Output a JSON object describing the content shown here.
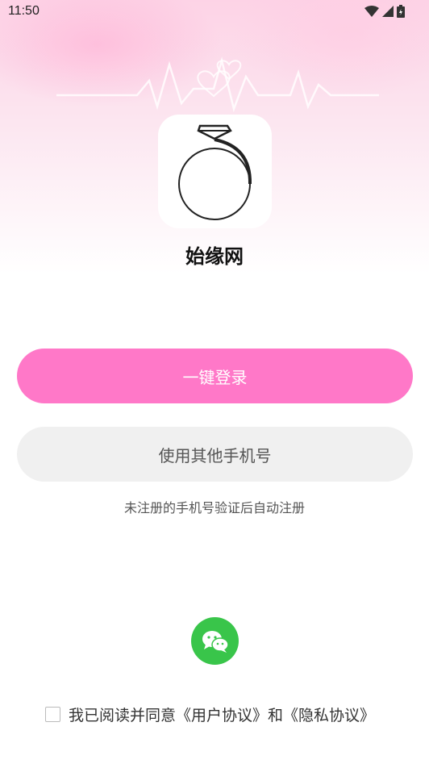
{
  "status_bar": {
    "time": "11:50"
  },
  "app": {
    "name": "始缘网",
    "logo_icon": "diamond-ring-icon"
  },
  "buttons": {
    "one_click_login": "一键登录",
    "other_phone": "使用其他手机号"
  },
  "hint": "未注册的手机号验证后自动注册",
  "social": {
    "wechat_icon": "wechat-icon"
  },
  "agreement": {
    "prefix": "我已阅读并同意",
    "user_agreement": "《用户协议》",
    "and": "和",
    "privacy_agreement": "《隐私协议》",
    "checked": false
  },
  "colors": {
    "primary": "#ff78c8",
    "secondary_bg": "#f0f0f0",
    "wechat": "#39c54a"
  }
}
